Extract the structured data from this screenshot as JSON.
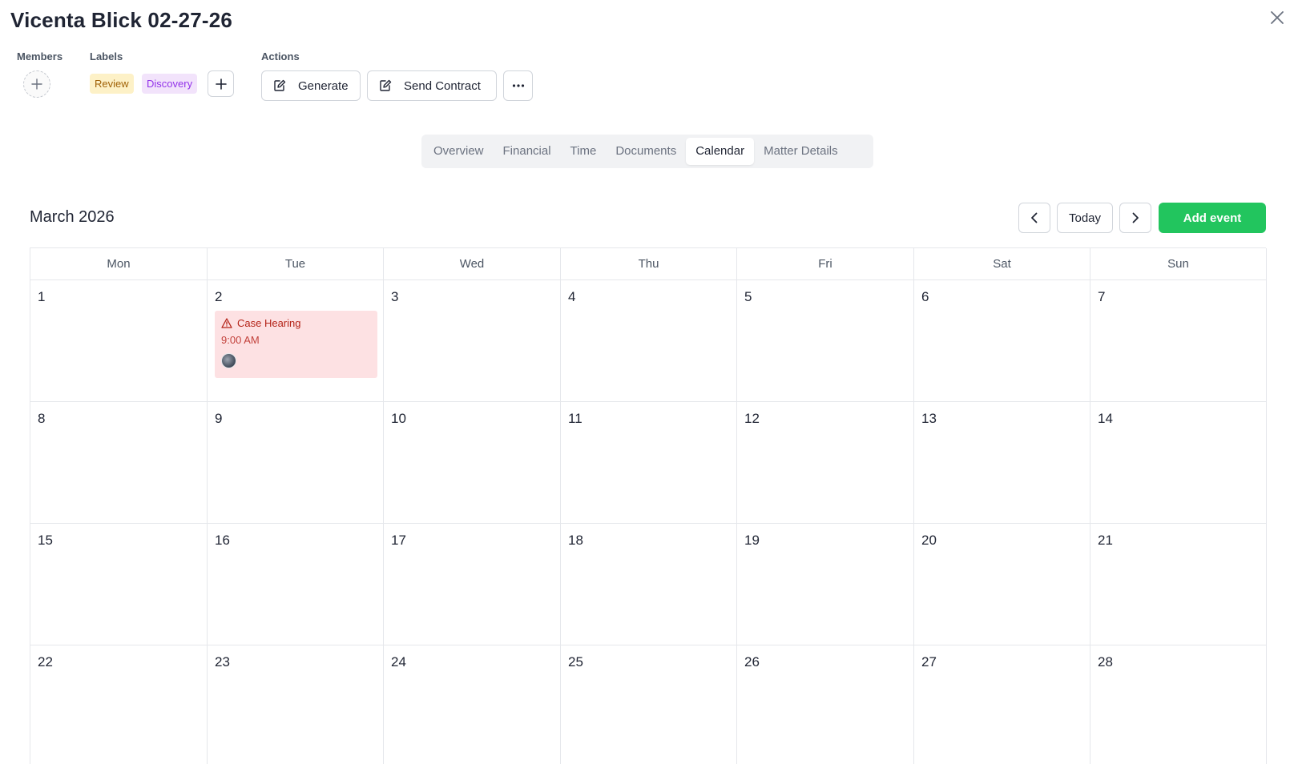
{
  "header": {
    "title": "Vicenta Blick 02-27-26",
    "close_icon": "close-icon"
  },
  "members": {
    "label": "Members",
    "add_icon": "plus-icon"
  },
  "labels": {
    "label": "Labels",
    "tags": [
      {
        "text": "Review",
        "bg": "#fdf1c7",
        "color": "#a16207"
      },
      {
        "text": "Discovery",
        "bg": "#f2e3fb",
        "color": "#9333ea"
      }
    ],
    "add_icon": "plus-icon"
  },
  "actions": {
    "label": "Actions",
    "generate_label": "Generate",
    "send_contract_label": "Send Contract",
    "more_icon": "ellipsis-icon"
  },
  "tabs": [
    {
      "label": "Overview",
      "active": false
    },
    {
      "label": "Financial",
      "active": false
    },
    {
      "label": "Time",
      "active": false
    },
    {
      "label": "Documents",
      "active": false
    },
    {
      "label": "Calendar",
      "active": true
    },
    {
      "label": "Matter Details",
      "active": false
    }
  ],
  "calendar": {
    "month_title": "March 2026",
    "today_label": "Today",
    "add_event_label": "Add event",
    "accent_color": "#22c55e",
    "weekdays": [
      "Mon",
      "Tue",
      "Wed",
      "Thu",
      "Fri",
      "Sat",
      "Sun"
    ],
    "days": [
      "1",
      "2",
      "3",
      "4",
      "5",
      "6",
      "7",
      "8",
      "9",
      "10",
      "11",
      "12",
      "13",
      "14",
      "15",
      "16",
      "17",
      "18",
      "19",
      "20",
      "21",
      "22",
      "23",
      "24",
      "25",
      "26",
      "27",
      "28"
    ],
    "events": [
      {
        "day": "2",
        "title": "Case Hearing",
        "time": "9:00 AM",
        "icon": "warning-icon",
        "bg": "#fde1e3",
        "color": "#b42318"
      }
    ]
  }
}
